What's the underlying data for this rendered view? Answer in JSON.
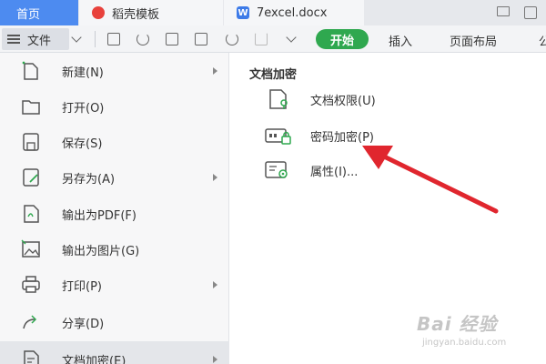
{
  "tabs": [
    {
      "label": "首页"
    },
    {
      "label": "稻壳模板"
    },
    {
      "label": "7excel.docx",
      "icon": "word-doc-icon"
    }
  ],
  "toolbar": {
    "file_label": "文件",
    "ribbon_tabs": [
      "开始",
      "插入",
      "页面布局",
      "公"
    ],
    "start_color": "#2fa84f"
  },
  "file_menu": {
    "items": [
      {
        "label": "新建(N)",
        "icon": "new-file-icon",
        "submenu": true
      },
      {
        "label": "打开(O)",
        "icon": "open-folder-icon",
        "submenu": false
      },
      {
        "label": "保存(S)",
        "icon": "save-icon",
        "submenu": false
      },
      {
        "label": "另存为(A)",
        "icon": "save-as-icon",
        "submenu": true
      },
      {
        "label": "输出为PDF(F)",
        "icon": "export-pdf-icon",
        "submenu": false
      },
      {
        "label": "输出为图片(G)",
        "icon": "export-image-icon",
        "submenu": false
      },
      {
        "label": "打印(P)",
        "icon": "print-icon",
        "submenu": true
      },
      {
        "label": "分享(D)",
        "icon": "share-icon",
        "submenu": false
      },
      {
        "label": "文档加密(E)",
        "icon": "document-encrypt-icon",
        "submenu": true,
        "active": true
      }
    ]
  },
  "submenu": {
    "title": "文档加密",
    "items": [
      {
        "label": "文档权限(U)",
        "icon": "document-permission-icon"
      },
      {
        "label": "密码加密(P)",
        "icon": "password-lock-icon"
      },
      {
        "label": "属性(I)...",
        "icon": "properties-icon"
      }
    ]
  },
  "annotation": {
    "color": "#e0262e",
    "icon": "red-arrow-pointer"
  },
  "watermark": {
    "main": "Bai 经验",
    "sub": "jingyan.baidu.com"
  }
}
